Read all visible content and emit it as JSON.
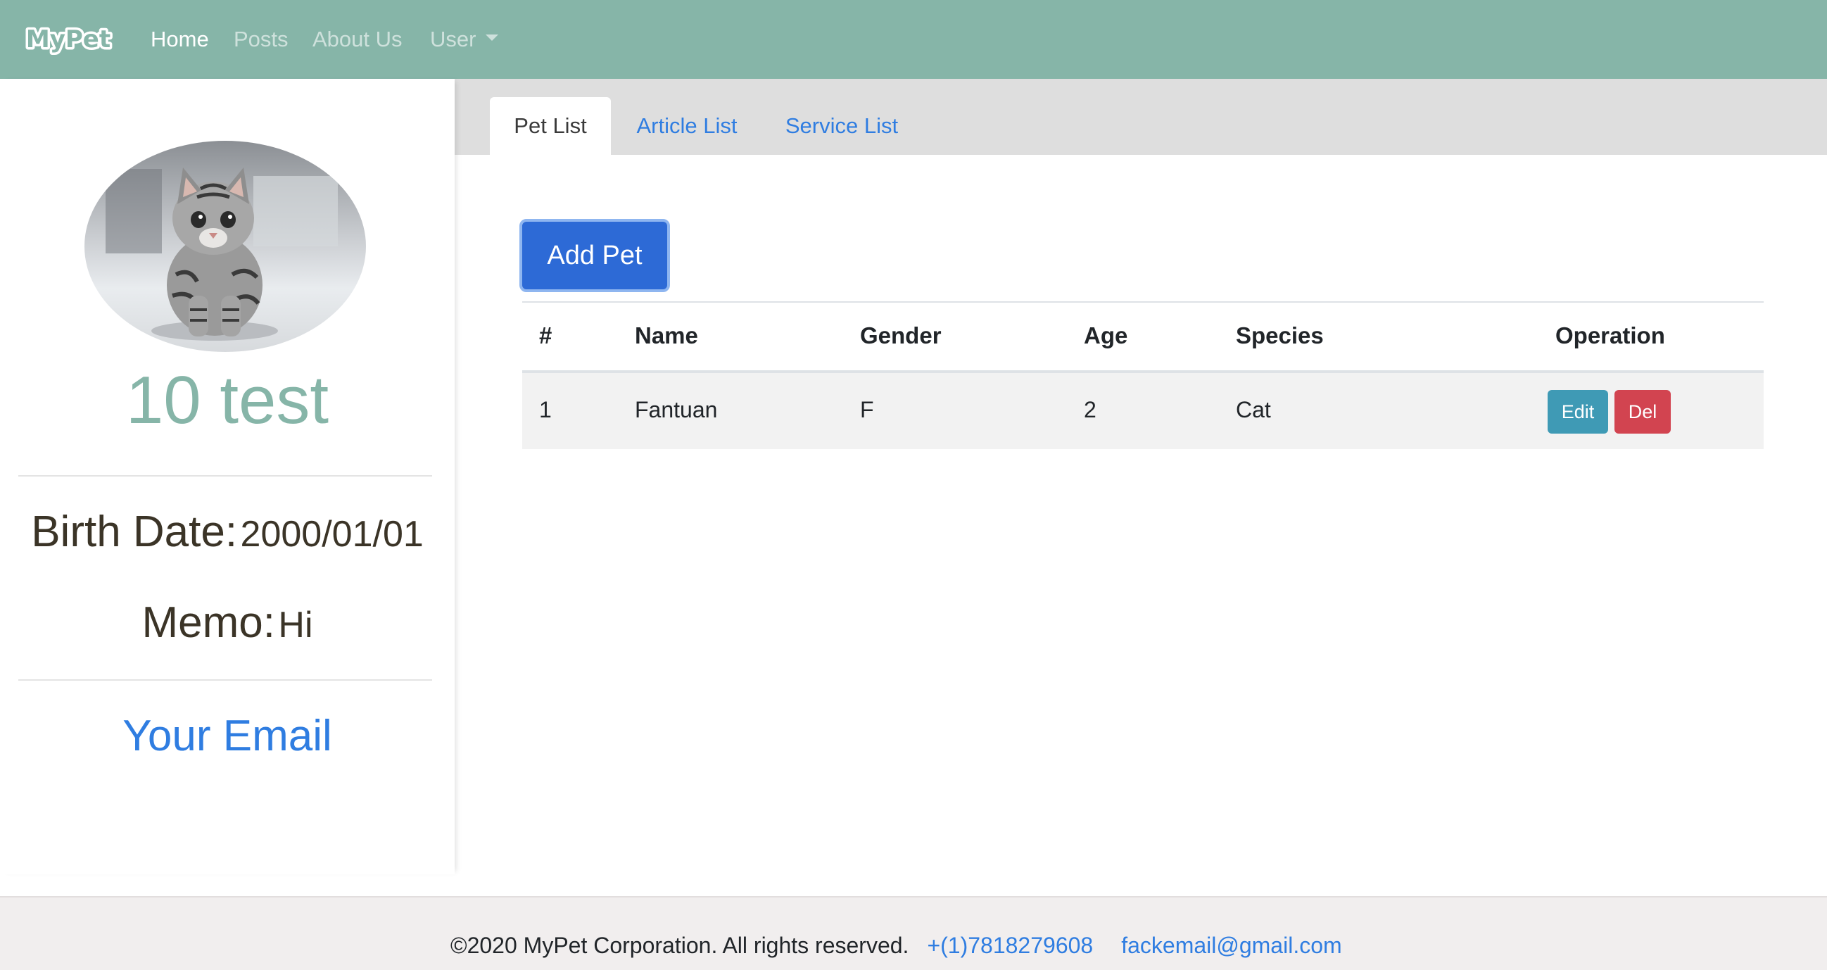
{
  "navbar": {
    "brand": "MyPet",
    "links": [
      {
        "label": "Home",
        "active": true
      },
      {
        "label": "Posts",
        "active": false
      },
      {
        "label": "About Us",
        "active": false
      },
      {
        "label": "User",
        "active": false
      }
    ],
    "color": "#86b5a8"
  },
  "profile": {
    "avatar_icon": "kitten-avatar",
    "name": "10 test",
    "birth_label": "Birth Date:",
    "birth_value": "2000/01/01",
    "memo_label": "Memo:",
    "memo_value": "Hi",
    "email_link": "Your Email"
  },
  "tabs": [
    {
      "label": "Pet List",
      "active": true
    },
    {
      "label": "Article List",
      "active": false
    },
    {
      "label": "Service List",
      "active": false
    }
  ],
  "pets": {
    "add_label": "Add Pet",
    "columns": [
      "#",
      "Name",
      "Gender",
      "Age",
      "Species",
      "Operation"
    ],
    "rows": [
      {
        "index": "1",
        "name": "Fantuan",
        "gender": "F",
        "age": "2",
        "species": "Cat",
        "edit_label": "Edit",
        "delete_label": "Del"
      }
    ]
  },
  "footer": {
    "copyright": "©2020 MyPet Corporation. All rights reserved.",
    "phone": "+(1)7818279608",
    "email": "fackemail@gmail.com"
  },
  "colors": {
    "accent": "#86b5a8",
    "link": "#2f7de1",
    "primary_button": "#2d6ad6",
    "edit_button": "#3f9ab5",
    "delete_button": "#d24450"
  }
}
